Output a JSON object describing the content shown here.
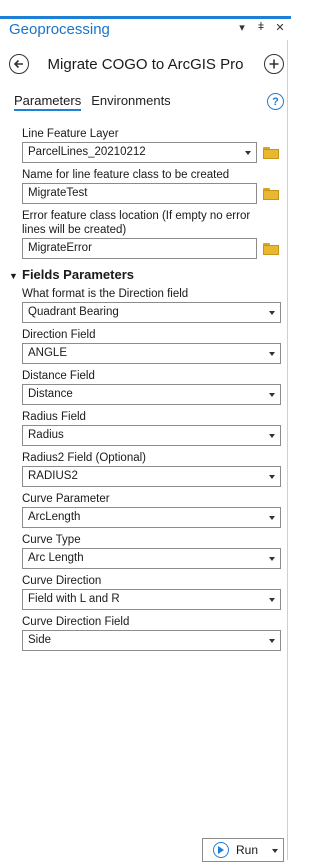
{
  "pane": {
    "title": "Geoprocessing",
    "menu_icon": "chevron-down-icon",
    "pin_icon": "pin-icon",
    "close_icon": "close-icon"
  },
  "tool": {
    "title": "Migrate COGO to ArcGIS Pro"
  },
  "tabs": [
    {
      "label": "Parameters",
      "active": true
    },
    {
      "label": "Environments",
      "active": false
    }
  ],
  "params": {
    "line_layer": {
      "label": "Line Feature Layer",
      "value": "ParcelLines_20210212"
    },
    "name_fc": {
      "label": "Name for line feature class to be created",
      "value": "MigrateTest"
    },
    "error_fc": {
      "label": "Error feature class location (If empty no error lines will be created)",
      "value": "MigrateError"
    }
  },
  "group": {
    "title": "Fields Parameters",
    "fields": [
      {
        "label": "What format is the Direction field",
        "value": "Quadrant Bearing"
      },
      {
        "label": "Direction Field",
        "value": "ANGLE"
      },
      {
        "label": "Distance Field",
        "value": "Distance"
      },
      {
        "label": "Radius Field",
        "value": "Radius"
      },
      {
        "label": "Radius2 Field (Optional)",
        "value": "RADIUS2"
      },
      {
        "label": "Curve Parameter",
        "value": "ArcLength"
      },
      {
        "label": "Curve Type",
        "value": "Arc Length"
      },
      {
        "label": "Curve Direction",
        "value": "Field with L and R"
      },
      {
        "label": "Curve Direction Field",
        "value": "Side"
      }
    ]
  },
  "run": {
    "label": "Run"
  },
  "colors": {
    "accent": "#1e7fd6",
    "folder": "#e9b830"
  }
}
